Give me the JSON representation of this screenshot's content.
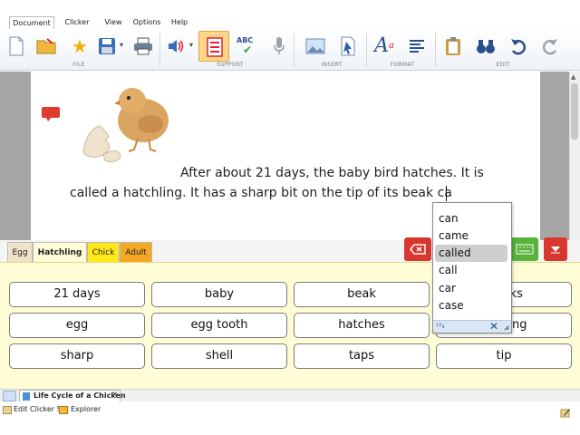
{
  "menu": {
    "tabs": [
      "Document",
      "Clicker Set",
      "View",
      "Options",
      "Help"
    ],
    "active": "Document"
  },
  "ribbon": {
    "groups": [
      "FILE",
      "SUPPORT",
      "INSERT",
      "FORMAT",
      "EDIT"
    ],
    "icons": {
      "new": "new-document-icon",
      "open": "open-folder-icon",
      "favorite": "star-icon",
      "save": "save-disk-icon",
      "print": "printer-icon",
      "speak": "speaker-icon",
      "predict": "word-prediction-icon",
      "spell": "spellcheck-icon",
      "spell_text": "ABC",
      "microphone": "microphone-icon",
      "insert_image": "insert-picture-icon",
      "insert_cursor": "insert-pointer-icon",
      "font": "font-style-icon",
      "align": "align-text-icon",
      "paste": "clipboard-icon",
      "find": "binoculars-icon",
      "undo": "undo-icon",
      "redo": "redo-icon"
    }
  },
  "document": {
    "lines": [
      "After about 21 days, the baby bird hatches. It is",
      "called a hatchling. It has a sharp bit on the tip of its beak ca"
    ]
  },
  "clicker": {
    "tabs": [
      {
        "label": "Egg",
        "color": "#efe3c8"
      },
      {
        "label": "Hatchling",
        "color": "#fffdd6"
      },
      {
        "label": "Chick",
        "color": "#ffe818"
      },
      {
        "label": "Adult",
        "color": "#f5a623"
      }
    ],
    "active": "Hatchling",
    "cells": [
      [
        "21 days",
        "baby",
        "beak",
        "cracks"
      ],
      [
        "egg",
        "egg tooth",
        "hatches",
        "pecking"
      ],
      [
        "sharp",
        "shell",
        "taps",
        "tip"
      ]
    ]
  },
  "prediction": {
    "items": [
      "can",
      "came",
      "called",
      "call",
      "car",
      "case"
    ],
    "selected": "called",
    "footer_badge": "¹²₃"
  },
  "doc_tab": {
    "title": "Life Cycle of a Chicken"
  },
  "status": {
    "edit_clicker": "Edit Clicker Set",
    "explorer": "Explorer"
  },
  "colors": {
    "red_button": "#d9372e",
    "green_button": "#58b33a",
    "grid_bg": "#fffdd6",
    "doc_gutter": "#a6a6a6"
  }
}
